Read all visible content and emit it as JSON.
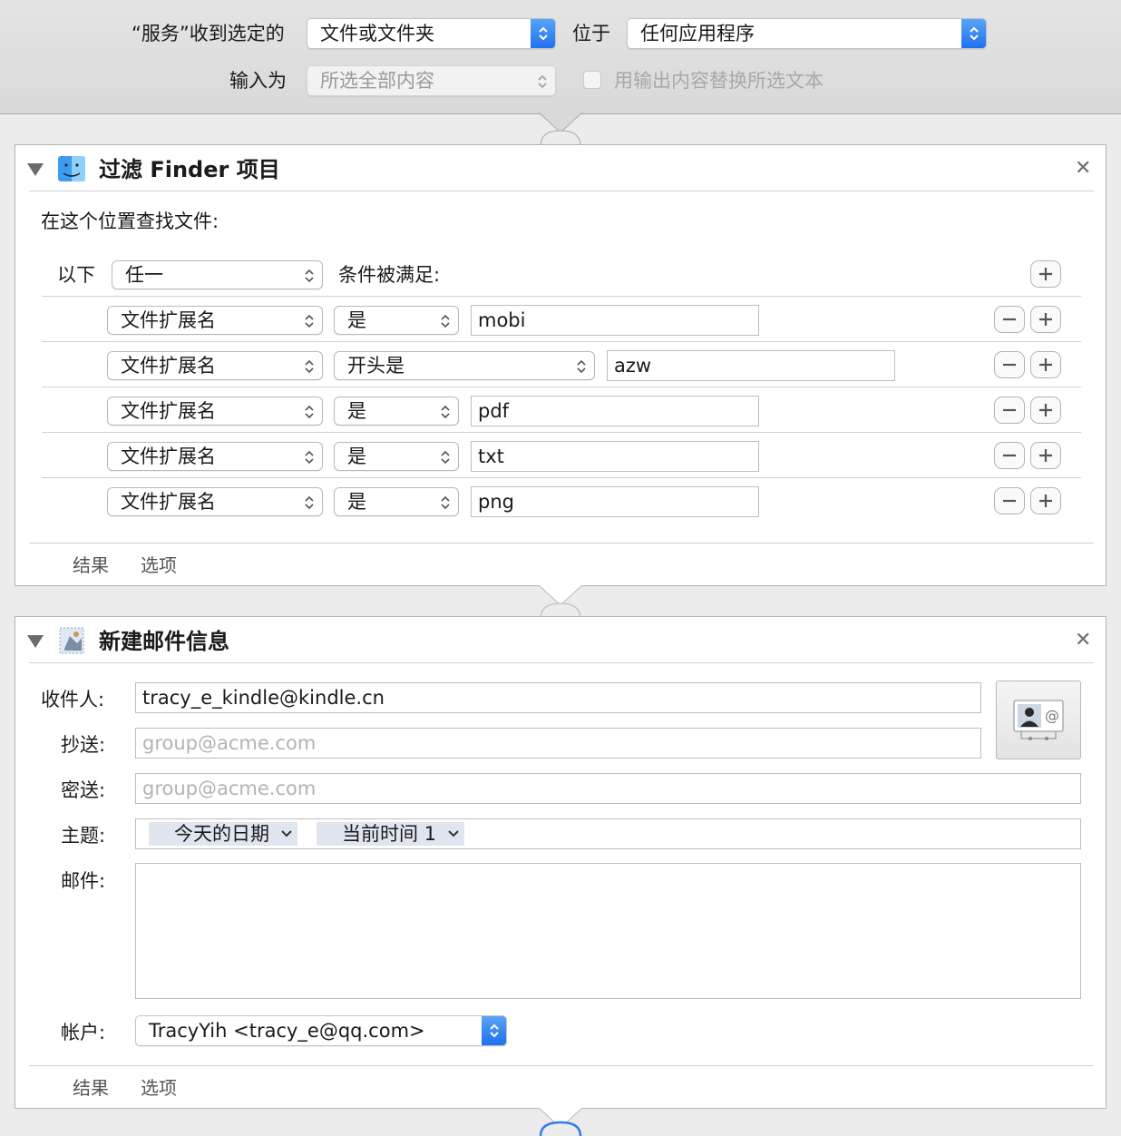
{
  "service_bar": {
    "receives_label": "“服务”收到选定的",
    "receives_value": "文件或文件夹",
    "in_label": "位于",
    "in_value": "任何应用程序",
    "input_label": "输入为",
    "input_value": "所选全部内容",
    "replace_label": "用输出内容替换所选文本"
  },
  "filter_action": {
    "title": "过滤 Finder 项目",
    "find_label": "在这个位置查找文件:",
    "match_prefix": "以下",
    "match_value": "任一",
    "match_suffix": "条件被满足:",
    "rules": [
      {
        "field": "文件扩展名",
        "operator": "是",
        "value": "mobi"
      },
      {
        "field": "文件扩展名",
        "operator": "开头是",
        "value": "azw"
      },
      {
        "field": "文件扩展名",
        "operator": "是",
        "value": "pdf"
      },
      {
        "field": "文件扩展名",
        "operator": "是",
        "value": "txt"
      },
      {
        "field": "文件扩展名",
        "operator": "是",
        "value": "png"
      }
    ],
    "tabs": [
      "结果",
      "选项"
    ]
  },
  "mail_action": {
    "title": "新建邮件信息",
    "to_label": "收件人:",
    "to_value": "tracy_e_kindle@kindle.cn",
    "cc_label": "抄送:",
    "cc_placeholder": "group@acme.com",
    "bcc_label": "密送:",
    "bcc_placeholder": "group@acme.com",
    "subject_label": "主题:",
    "subject_tokens": [
      "今天的日期",
      "当前时间 1"
    ],
    "body_label": "邮件:",
    "account_label": "帐户:",
    "account_value": "TracyYih <tracy_e@qq.com>",
    "tabs": [
      "结果",
      "选项"
    ]
  },
  "colors": {
    "accent": "#1e6ff0",
    "token_bg": "#dfe6ef"
  }
}
